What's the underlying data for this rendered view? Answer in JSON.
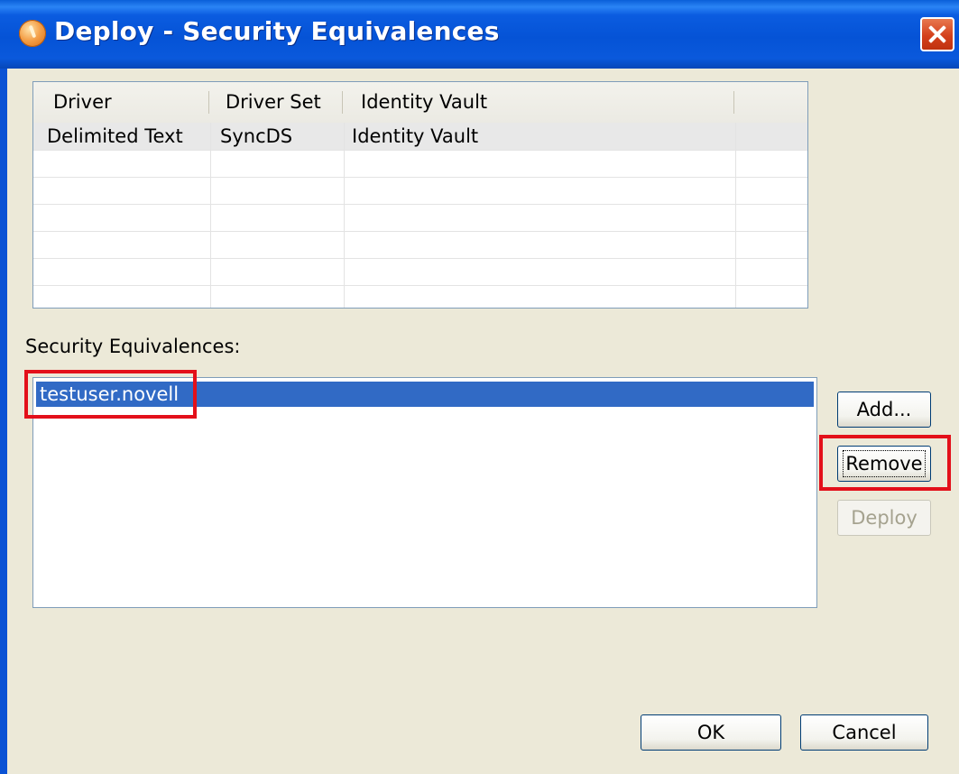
{
  "window": {
    "title": "Deploy - Security Equivalences"
  },
  "table": {
    "columns": [
      "Driver",
      "Driver Set",
      "Identity Vault"
    ],
    "rows": [
      [
        "Delimited Text",
        "SyncDS",
        "Identity Vault"
      ]
    ]
  },
  "security": {
    "label": "Security Equivalences:",
    "items": [
      "testuser.novell"
    ]
  },
  "buttons": {
    "add": "Add...",
    "remove": "Remove",
    "deploy": "Deploy",
    "ok": "OK",
    "cancel": "Cancel"
  },
  "colors": {
    "titlebar": "#0553d6",
    "selection": "#316ac5",
    "highlight": "#e3101a",
    "dialog_bg": "#ece9d8"
  },
  "icons": {
    "title": "app-globe-icon",
    "close": "close-icon"
  }
}
